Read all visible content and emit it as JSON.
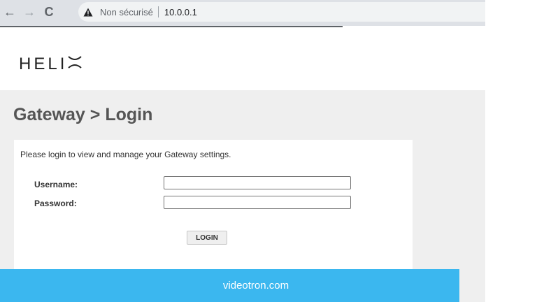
{
  "browser": {
    "nav": {
      "back_glyph": "←",
      "forward_glyph": "→",
      "reload_glyph": "C"
    },
    "security_label": "Non sécurisé",
    "url": "10.0.0.1"
  },
  "brand": {
    "logo_text": "HELI",
    "logo_mark_icon": "helix-x-mark"
  },
  "page": {
    "title": "Gateway > Login",
    "intro": "Please login to view and manage your Gateway settings."
  },
  "form": {
    "username_label": "Username:",
    "password_label": "Password:",
    "username_value": "",
    "password_value": "",
    "login_button": "LOGIN"
  },
  "footer": {
    "link_text": "videotron.com"
  },
  "colors": {
    "footer_bg": "#3bb7ef",
    "panel_bg": "#efefef",
    "title_color": "#555555"
  }
}
